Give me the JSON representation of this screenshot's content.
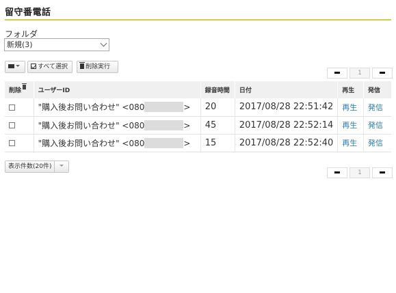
{
  "page": {
    "title": "留守番電話"
  },
  "folder": {
    "label": "フォルダ",
    "selected": "新規(3)"
  },
  "toolbar": {
    "menu_icon": "menu-dropdown-icon",
    "select_all_label": "すべて選択",
    "delete_label": "削除実行"
  },
  "pager": {
    "current_page": "1"
  },
  "table": {
    "headers": {
      "delete": "削除",
      "user_id": "ユーザーID",
      "duration": "録音時間",
      "date": "日付",
      "play": "再生",
      "call": "発信"
    },
    "rows": [
      {
        "user_id": "\"購入後お問い合わせ\" <080",
        "user_id_suffix": ">",
        "duration": "20",
        "date": "2017/08/28 22:51:42",
        "play": "再生",
        "call": "発信"
      },
      {
        "user_id": "\"購入後お問い合わせ\" <080",
        "user_id_suffix": ">",
        "duration": "45",
        "date": "2017/08/28 22:52:14",
        "play": "再生",
        "call": "発信"
      },
      {
        "user_id": "\"購入後お問い合わせ\" <080",
        "user_id_suffix": ">",
        "duration": "15",
        "date": "2017/08/28 22:52:40",
        "play": "再生",
        "call": "発信"
      }
    ]
  },
  "display_count": {
    "label": "表示件数(20件)"
  },
  "colors": {
    "accent_rule": "#d8c84a",
    "link": "#2a7ab0",
    "header_bg": "#f0f0f0"
  }
}
